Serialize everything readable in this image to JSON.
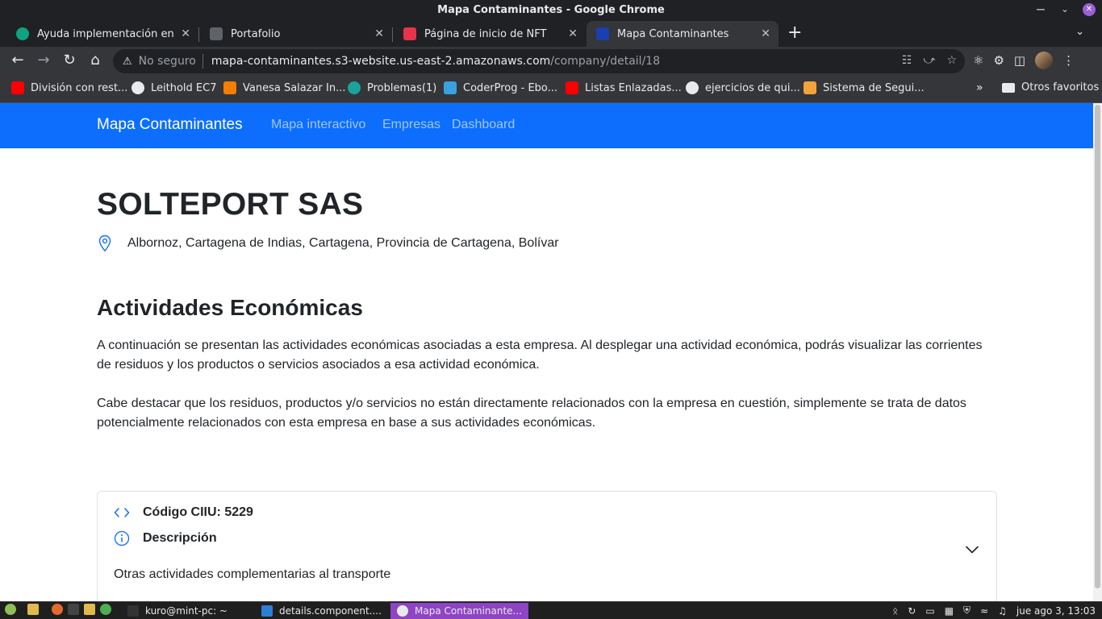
{
  "window": {
    "title": "Mapa Contaminantes - Google Chrome"
  },
  "tabs": [
    {
      "label": "Ayuda implementación en GitHub"
    },
    {
      "label": "Portafolio"
    },
    {
      "label": "Página de inicio de NFT"
    },
    {
      "label": "Mapa Contaminantes"
    }
  ],
  "toolbar": {
    "security_label": "No seguro",
    "url_host": "mapa-contaminantes.s3-website.us-east-2.amazonaws.com",
    "url_path": "/company/detail/18"
  },
  "bookmarks": [
    {
      "label": "División con rest..."
    },
    {
      "label": "Leithold EC7"
    },
    {
      "label": "Vanesa Salazar In..."
    },
    {
      "label": "Problemas(1)"
    },
    {
      "label": "CoderProg - Ebo..."
    },
    {
      "label": "Listas Enlazadas..."
    },
    {
      "label": "ejercicios de qui..."
    },
    {
      "label": "Sistema de Segui..."
    }
  ],
  "bookmarks_other": "Otros favoritos",
  "site": {
    "brand": "Mapa Contaminantes",
    "nav": [
      "Mapa interactivo",
      "Empresas",
      "Dashboard"
    ]
  },
  "company": {
    "name": "SOLTEPORT SAS",
    "address": "Albornoz, Cartagena de Indias, Cartagena, Provincia de Cartagena, Bolívar"
  },
  "activities": {
    "title": "Actividades Económicas",
    "paragraph1": "A continuación se presentan las actividades económicas asociadas a esta empresa. Al desplegar una actividad económica, podrás visualizar las corrientes de residuos y los productos o servicios asociados a esa actividad económica.",
    "paragraph2": "Cabe destacar que los residuos, productos y/o servicios no están directamente relacionados con la empresa en cuestión, simplemente se trata de datos potencialmente relacionados con esta empresa en base a sus actividades económicas.",
    "items": [
      {
        "code_label": "Código CIIU: 5229",
        "desc_label": "Descripción",
        "description": "Otras actividades complementarias al transporte"
      }
    ]
  },
  "taskbar": {
    "apps": [
      {
        "label": "kuro@mint-pc: ~"
      },
      {
        "label": "details.component...."
      },
      {
        "label": "Mapa Contaminante..."
      }
    ],
    "clock": "jue ago  3, 13:03"
  },
  "colors": {
    "navbar": "#0d6efd",
    "chrome_dark": "#202124",
    "chrome_toolbar": "#35363a"
  }
}
